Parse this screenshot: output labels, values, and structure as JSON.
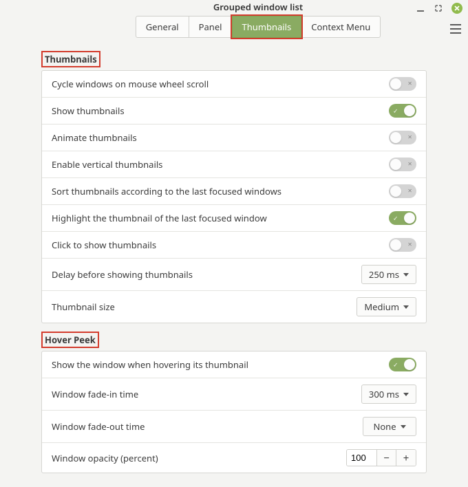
{
  "window": {
    "title": "Grouped window list"
  },
  "tabs": [
    {
      "label": "General"
    },
    {
      "label": "Panel"
    },
    {
      "label": "Thumbnails"
    },
    {
      "label": "Context Menu"
    }
  ],
  "sections": {
    "thumbnails": {
      "title": "Thumbnails",
      "rows": {
        "cycle": {
          "label": "Cycle windows on mouse wheel scroll",
          "value": false
        },
        "show": {
          "label": "Show thumbnails",
          "value": true
        },
        "animate": {
          "label": "Animate thumbnails",
          "value": false
        },
        "vertical": {
          "label": "Enable vertical thumbnails",
          "value": false
        },
        "sort": {
          "label": "Sort thumbnails according to the last focused windows",
          "value": false
        },
        "highlight": {
          "label": "Highlight the thumbnail of the last focused window",
          "value": true
        },
        "click": {
          "label": "Click to show thumbnails",
          "value": false
        },
        "delay": {
          "label": "Delay before showing thumbnails",
          "value": "250 ms"
        },
        "size": {
          "label": "Thumbnail size",
          "value": "Medium"
        }
      }
    },
    "hover": {
      "title": "Hover Peek",
      "rows": {
        "showwin": {
          "label": "Show the window when hovering its thumbnail",
          "value": true
        },
        "fadein": {
          "label": "Window fade-in time",
          "value": "300 ms"
        },
        "fadeout": {
          "label": "Window fade-out time",
          "value": "None"
        },
        "opacity": {
          "label": "Window opacity (percent)",
          "value": "100"
        }
      }
    }
  }
}
